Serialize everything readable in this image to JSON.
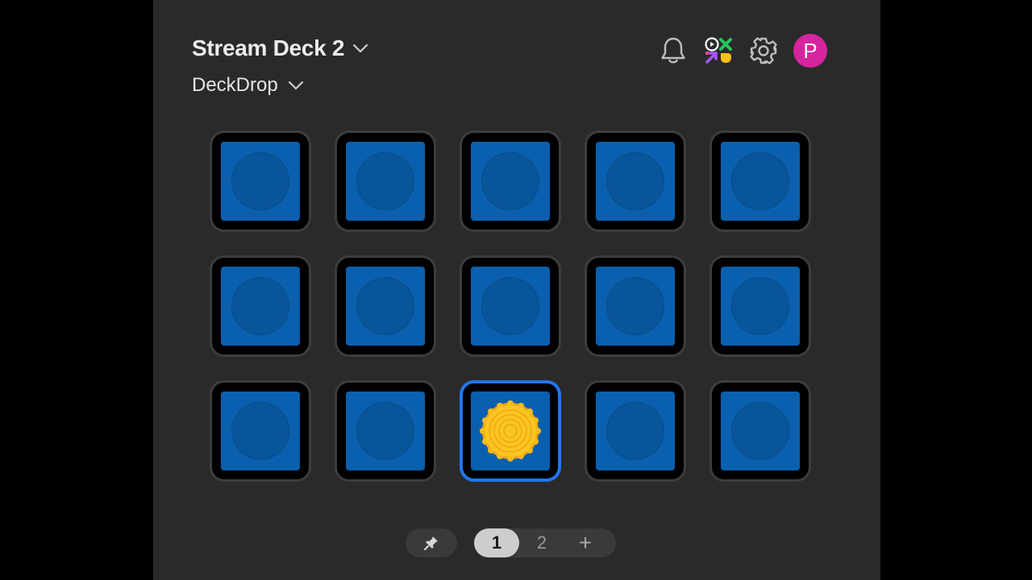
{
  "header": {
    "device_name": "Stream Deck 2",
    "profile_name": "DeckDrop"
  },
  "icons": {
    "notifications": "bell-icon",
    "marketplace": "marketplace-icon",
    "settings": "gear-icon",
    "avatar_letter": "P"
  },
  "colors": {
    "background": "#2a2a2a",
    "key_face": "#0a60ae",
    "selection": "#1e78f0",
    "avatar": "#d6249f",
    "coin": "#f8c21b"
  },
  "keys": {
    "rows": 3,
    "columns": 5,
    "selected_index": 12,
    "selected_icon": "gold-coin-icon"
  },
  "pager": {
    "pages": [
      "1",
      "2"
    ],
    "active_page": "1",
    "add_label": "+",
    "pin_icon": "pin-icon"
  }
}
